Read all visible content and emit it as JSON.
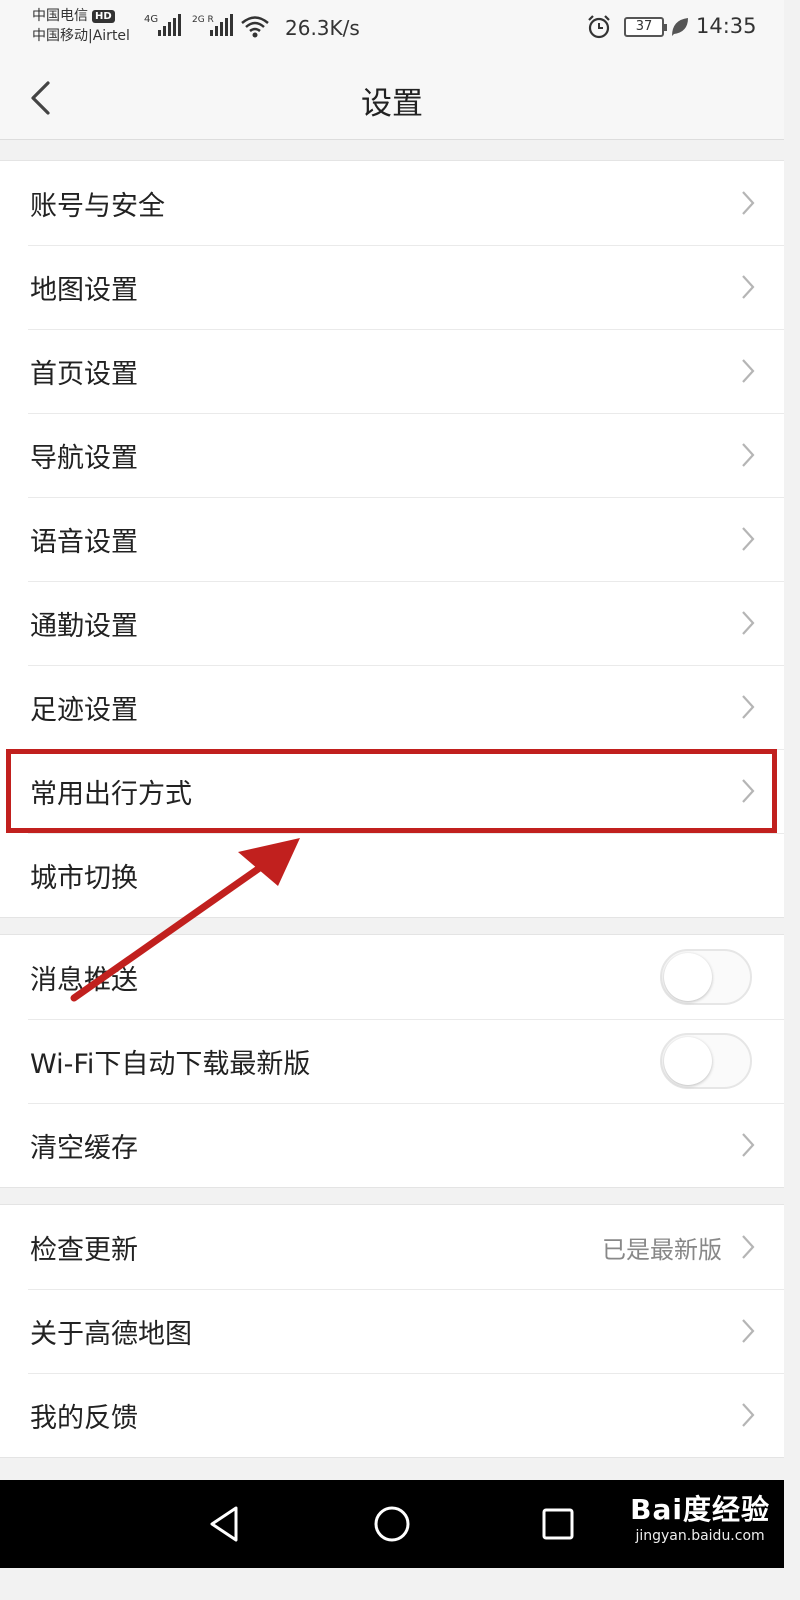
{
  "status_bar": {
    "carrier1": "中国电信",
    "carrier1_badge": "HD",
    "carrier2": "中国移动|Airtel",
    "network1": "4G",
    "network2": "2G R",
    "net_speed": "26.3K/s",
    "battery_level": "37",
    "time": "14:35"
  },
  "nav": {
    "title": "设置"
  },
  "groups": [
    {
      "items": [
        {
          "label": "账号与安全"
        },
        {
          "label": "地图设置"
        },
        {
          "label": "首页设置"
        },
        {
          "label": "导航设置"
        },
        {
          "label": "语音设置"
        },
        {
          "label": "通勤设置"
        },
        {
          "label": "足迹设置"
        },
        {
          "label": "常用出行方式"
        },
        {
          "label": "城市切换"
        }
      ]
    },
    {
      "items": [
        {
          "label": "消息推送",
          "toggle": false
        },
        {
          "label": "Wi-Fi下自动下载最新版",
          "toggle": false
        },
        {
          "label": "清空缓存"
        }
      ]
    },
    {
      "items": [
        {
          "label": "检查更新",
          "value": "已是最新版"
        },
        {
          "label": "关于高德地图"
        },
        {
          "label": "我的反馈"
        }
      ]
    }
  ],
  "watermark": {
    "brand": "Bai度经验",
    "url": "jingyan.baidu.com"
  },
  "colors": {
    "highlight": "#c1201e",
    "background": "#f2f2f2"
  }
}
